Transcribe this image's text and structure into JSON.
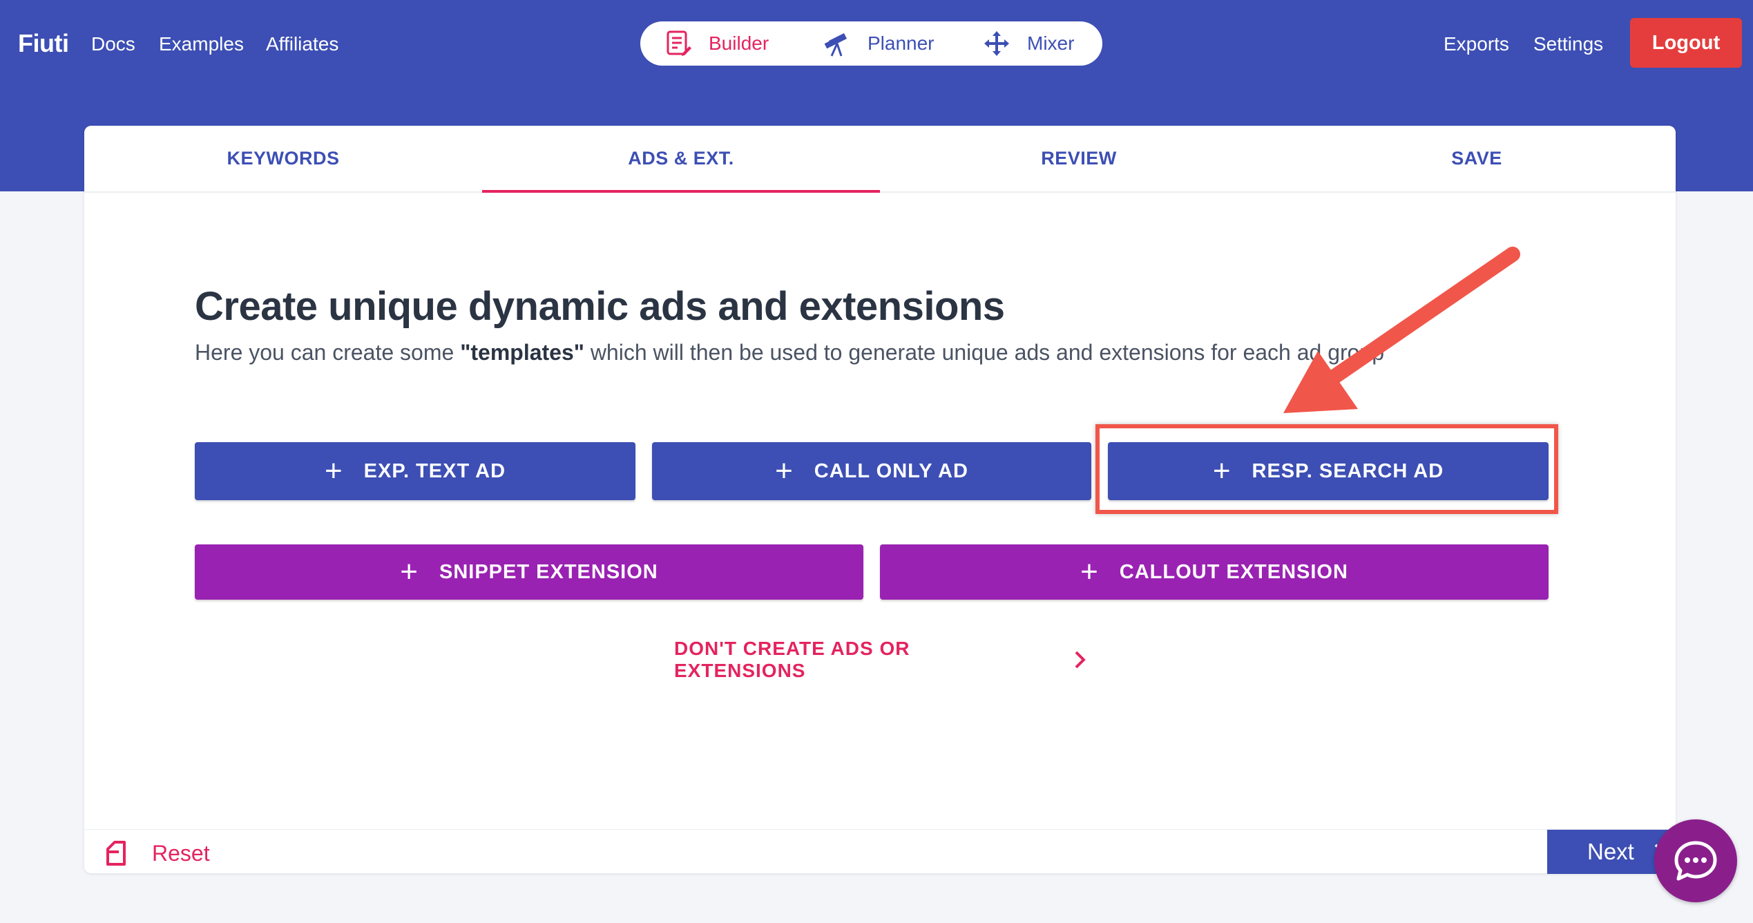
{
  "header": {
    "brand": "Fiuti",
    "nav_left": [
      "Docs",
      "Examples",
      "Affiliates"
    ],
    "modes": [
      {
        "label": "Builder",
        "icon": "list-edit-icon",
        "active": true
      },
      {
        "label": "Planner",
        "icon": "telescope-icon",
        "active": false
      },
      {
        "label": "Mixer",
        "icon": "arrows-split-icon",
        "active": false
      }
    ],
    "nav_right": [
      "Exports",
      "Settings"
    ],
    "logout_label": "Logout"
  },
  "tabs": [
    {
      "label": "KEYWORDS",
      "active": false
    },
    {
      "label": "ADS & EXT.",
      "active": true
    },
    {
      "label": "REVIEW",
      "active": false
    },
    {
      "label": "SAVE",
      "active": false
    }
  ],
  "main": {
    "heading": "Create unique dynamic ads and extensions",
    "sub_before": "Here you can create some ",
    "sub_bold": "\"templates\"",
    "sub_after": " which will then be used to generate unique ads and extensions for each ad group",
    "ad_buttons": [
      "EXP. TEXT AD",
      "CALL ONLY AD",
      "RESP. SEARCH AD"
    ],
    "ext_buttons": [
      "SNIPPET EXTENSION",
      "CALLOUT EXTENSION"
    ],
    "skip_link": "DON'T CREATE ADS OR EXTENSIONS"
  },
  "footer": {
    "reset_label": "Reset",
    "next_label": "Next"
  },
  "colors": {
    "primary": "#3d4fb4",
    "accent": "#e4245f",
    "purple": "#9a22b2",
    "logout": "#e53d3d",
    "annotation": "#f1564a"
  }
}
